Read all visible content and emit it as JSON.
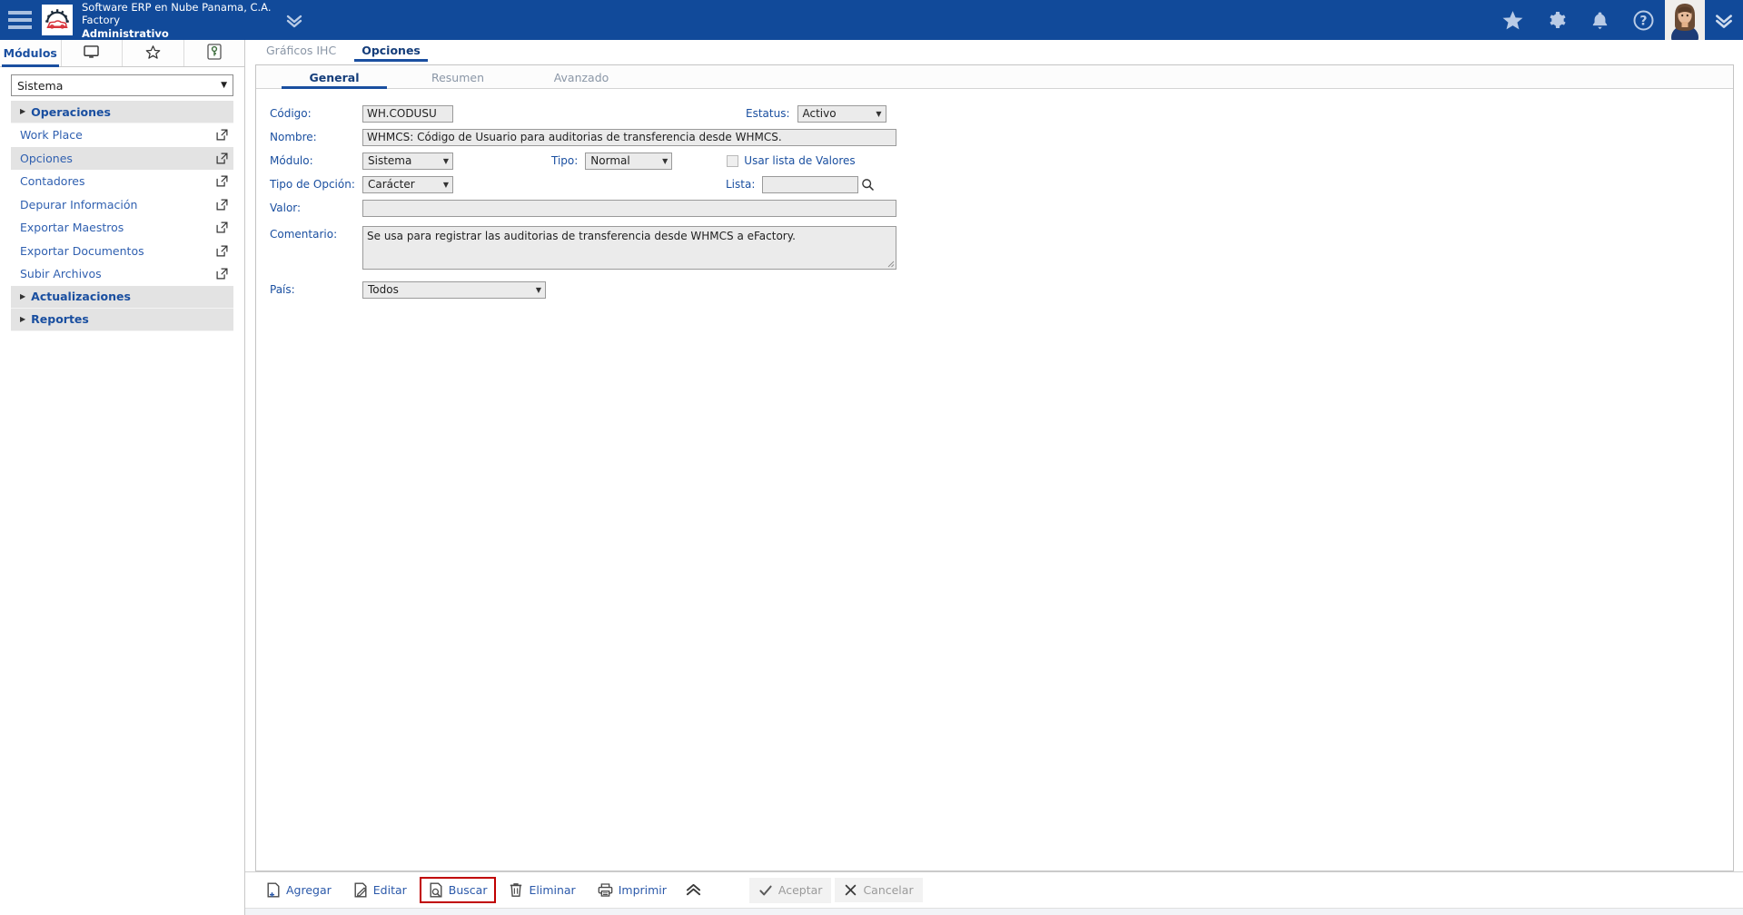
{
  "header": {
    "menu_icon": "hamburger-icon",
    "logo_icon": "company-logo-gear-car",
    "company": "Software ERP en Nube Panama, C.A.",
    "product": "Factory",
    "profile": "Administrativo",
    "expand_icon": "chevron-double-down-icon",
    "icons": [
      {
        "name": "favorites-icon",
        "glyph": "star"
      },
      {
        "name": "settings-icon",
        "glyph": "gear"
      },
      {
        "name": "notifications-icon",
        "glyph": "bell"
      },
      {
        "name": "help-icon",
        "glyph": "question-circle"
      }
    ],
    "avatar_name": "user-avatar",
    "avatar_chevron": "chevron-double-down-icon",
    "bg_color": "#114a9a"
  },
  "sidebar": {
    "tabs": [
      {
        "label": "Módulos",
        "name": "sidebar-tab-modulos",
        "icon": "",
        "active": true
      },
      {
        "label": "",
        "name": "sidebar-tab-escritorio",
        "icon": "monitor-icon",
        "active": false
      },
      {
        "label": "",
        "name": "sidebar-tab-favoritos",
        "icon": "star-outline-icon",
        "active": false
      },
      {
        "label": "",
        "name": "sidebar-tab-permisos",
        "icon": "key-icon",
        "active": false
      }
    ],
    "module_select": {
      "value": "Sistema",
      "caret": "▼"
    },
    "nav": [
      {
        "type": "group",
        "label": "Operaciones",
        "name": "nav-group-operaciones",
        "expanded": true
      },
      {
        "type": "item",
        "label": "Work Place",
        "name": "nav-item-work-place",
        "shaded": false
      },
      {
        "type": "item",
        "label": "Opciones",
        "name": "nav-item-opciones",
        "shaded": true
      },
      {
        "type": "item",
        "label": "Contadores",
        "name": "nav-item-contadores",
        "shaded": false
      },
      {
        "type": "item",
        "label": "Depurar Información",
        "name": "nav-item-depurar-informacion",
        "shaded": false
      },
      {
        "type": "item",
        "label": "Exportar Maestros",
        "name": "nav-item-exportar-maestros",
        "shaded": false
      },
      {
        "type": "item",
        "label": "Exportar Documentos",
        "name": "nav-item-exportar-documentos",
        "shaded": false
      },
      {
        "type": "item",
        "label": "Subir Archivos",
        "name": "nav-item-subir-archivos",
        "shaded": false
      },
      {
        "type": "group",
        "label": "Actualizaciones",
        "name": "nav-group-actualizaciones",
        "expanded": false
      },
      {
        "type": "group",
        "label": "Reportes",
        "name": "nav-group-reportes",
        "expanded": false
      }
    ]
  },
  "main": {
    "doc_tabs": [
      {
        "label": "Gráficos IHC",
        "name": "tab-graficos-ihc",
        "active": false
      },
      {
        "label": "Opciones",
        "name": "tab-opciones",
        "active": true
      }
    ],
    "inner_tabs": [
      {
        "label": "General",
        "name": "tab-general",
        "active": true
      },
      {
        "label": "Resumen",
        "name": "tab-resumen",
        "active": false
      },
      {
        "label": "Avanzado",
        "name": "tab-avanzado",
        "active": false
      }
    ],
    "form": {
      "codigo_label": "Código:",
      "codigo_value": "WH.CODUSU",
      "estatus_label": "Estatus:",
      "estatus_value": "Activo",
      "nombre_label": "Nombre:",
      "nombre_value": "WHMCS: Código de Usuario para auditorias de transferencia desde WHMCS.",
      "modulo_label": "Módulo:",
      "modulo_value": "Sistema",
      "tipo_label": "Tipo:",
      "tipo_value": "Normal",
      "usar_lista_label": "Usar lista de Valores",
      "usar_lista_checked": false,
      "tipo_opcion_label": "Tipo de Opción:",
      "tipo_opcion_value": "Carácter",
      "lista_label": "Lista:",
      "lista_value": "",
      "lista_search_icon": "search-icon",
      "valor_label": "Valor:",
      "valor_value": "",
      "comentario_label": "Comentario:",
      "comentario_value": "Se usa para registrar las auditorias de transferencia desde WHMCS a eFactory.",
      "pais_label": "País:",
      "pais_value": "Todos"
    },
    "toolbar": [
      {
        "label": "Agregar",
        "name": "agregar-button",
        "icon": "add-document-icon",
        "state": "enabled"
      },
      {
        "label": "Editar",
        "name": "editar-button",
        "icon": "edit-document-icon",
        "state": "enabled"
      },
      {
        "label": "Buscar",
        "name": "buscar-button",
        "icon": "search-document-icon",
        "state": "highlighted"
      },
      {
        "label": "Eliminar",
        "name": "eliminar-button",
        "icon": "trash-icon",
        "state": "enabled"
      },
      {
        "label": "Imprimir",
        "name": "imprimir-button",
        "icon": "printer-icon",
        "state": "enabled"
      }
    ],
    "collapse_icon": "chevron-double-up-icon",
    "confirm": [
      {
        "label": "Aceptar",
        "name": "aceptar-button",
        "icon": "check-icon",
        "state": "disabled"
      },
      {
        "label": "Cancelar",
        "name": "cancelar-button",
        "icon": "close-x-icon",
        "state": "disabled"
      }
    ],
    "highlight_color": "#c00000"
  }
}
